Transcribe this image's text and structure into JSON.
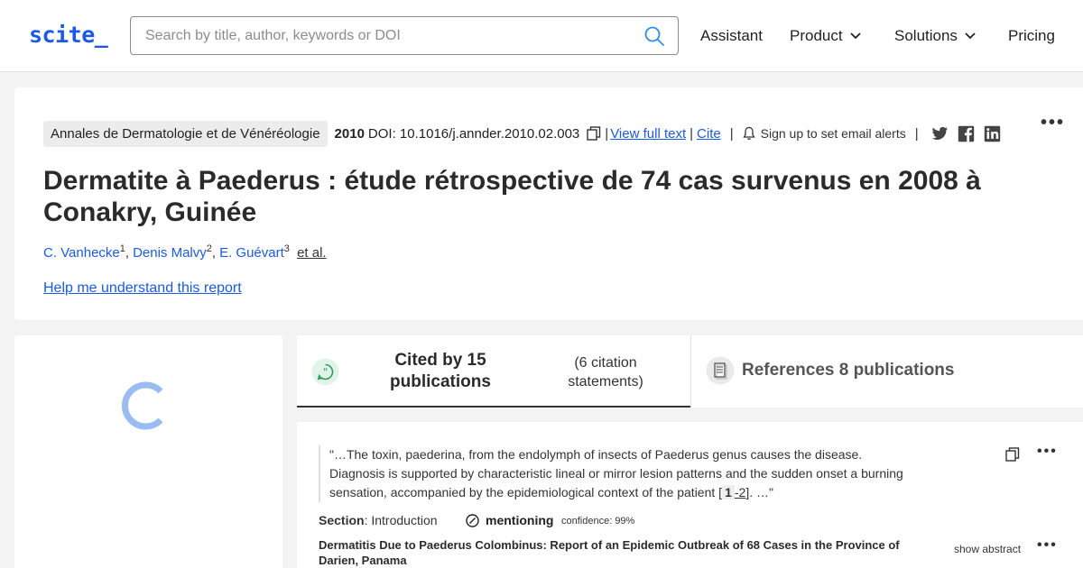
{
  "header": {
    "logo": "scite_",
    "search_placeholder": "Search by title, author, keywords or DOI",
    "nav": [
      {
        "label": "Assistant",
        "dropdown": false
      },
      {
        "label": "Product",
        "dropdown": true
      },
      {
        "label": "Solutions",
        "dropdown": true
      },
      {
        "label": "Pricing",
        "dropdown": false
      }
    ]
  },
  "article": {
    "journal": "Annales de Dermatologie et de Vénéréologie",
    "year": "2010",
    "doi": "DOI: 10.1016/j.annder.2010.02.003",
    "view_full_text": "View full text",
    "cite": "Cite",
    "separator": "|",
    "alert_text": "Sign up to set email alerts",
    "title": "Dermatite à Paederus : étude rétrospective de 74 cas survenus en 2008 à Conakry, Guinée",
    "authors": [
      {
        "name": "C. Vanhecke",
        "sup": "1"
      },
      {
        "name": "Denis Malvy",
        "sup": "2"
      },
      {
        "name": "E. Guévart",
        "sup": "3"
      }
    ],
    "author_separator": ",",
    "et_al": "et al.",
    "help_link": "Help me understand this report",
    "more": "•••"
  },
  "tabs": {
    "cited_label": "Cited by 15 publications",
    "cited_sub": "(6 citation statements)",
    "references_label": "References 8 publications"
  },
  "citation": {
    "quote_start": "\"…The toxin, paederina, from the endolymph of insects of Paederus genus causes the disease. Diagnosis is supported by characteristic lineal or mirror lesion patterns and the sudden onset a burning sensation, accompanied by the epidemiological context of the patient [",
    "ref_num": "1",
    "ref_range": "-2",
    "quote_end": "]. …\"",
    "section_label": "Section",
    "section_value": ": Introduction",
    "mention_label": "mentioning",
    "confidence": "confidence: 99%",
    "paper_title": "Dermatitis Due to Paederus Colombinus: Report of an Epidemic Outbreak of 68 Cases in the Province of Darien, Panama",
    "show_abstract": "show abstract",
    "more": "•••"
  },
  "colors": {
    "brand": "#1a5ae6",
    "chat_icon": "#2e9e5b",
    "spinner": "#9bbcf0"
  }
}
